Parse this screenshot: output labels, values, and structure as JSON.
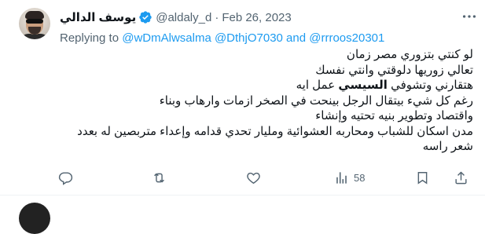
{
  "tweet": {
    "display_name": "يوسف الدالي",
    "handle": "@aldaly_d",
    "separator": "·",
    "date": "Feb 26, 2023",
    "reply_prefix": "Replying to",
    "reply_mentions": "@wDmAlwsalma @DthjO7030 and @rrroos20301",
    "lines": [
      "لو كنتي بتزوري مصر زمان",
      "تعالي زوريها دلوقتي وانتي نفسك",
      "هتقارني وتشوفي ",
      "السيسي",
      " عمل ايه",
      "رغم كل شيء بيتقال الرجل بينحت في الصخر ازمات وارهاب وبناء",
      "واقتصاد وتطوير بنيه تحتيه وإنشاء",
      "مدن اسكان للشباب ومحاربه العشوائية ومليار تحدي قدامه وإعداء متربصين له بعدد",
      "شعر راسه"
    ],
    "actions": {
      "reply_count": "",
      "retweet_count": "",
      "like_count": "",
      "views_count": "58"
    }
  },
  "colors": {
    "text_primary": "#0f1419",
    "text_secondary": "#536471",
    "link": "#1d9bf0",
    "verified": "#1d9bf0"
  }
}
